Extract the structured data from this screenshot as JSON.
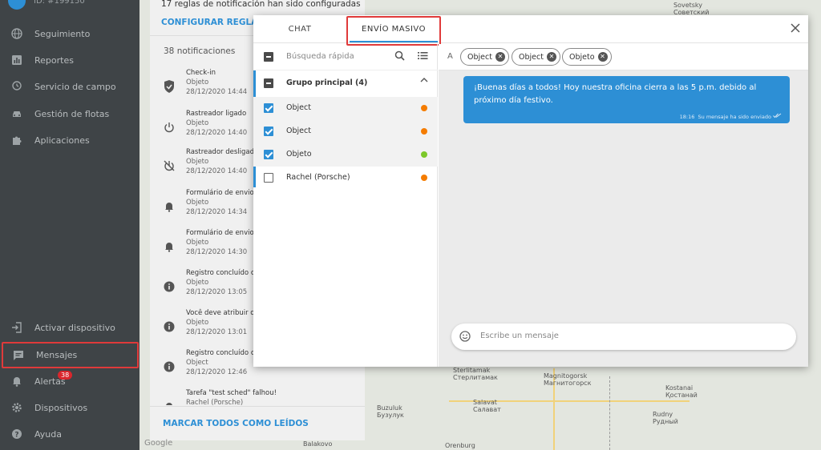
{
  "sidebar": {
    "user_id": "ID: #199150",
    "items": [
      {
        "label": "Seguimiento",
        "icon": "globe-icon"
      },
      {
        "label": "Reportes",
        "icon": "bar-chart-icon"
      },
      {
        "label": "Servicio de campo",
        "icon": "location-pin-icon"
      },
      {
        "label": "Gestión de flotas",
        "icon": "car-icon"
      },
      {
        "label": "Aplicaciones",
        "icon": "puzzle-icon"
      },
      {
        "label": "Activar dispositivo",
        "icon": "login-icon"
      },
      {
        "label": "Mensajes",
        "icon": "chat-icon"
      },
      {
        "label": "Alertas",
        "icon": "bell-icon",
        "badge": "38"
      },
      {
        "label": "Dispositivos",
        "icon": "gear-icon"
      },
      {
        "label": "Ayuda",
        "icon": "help-icon"
      }
    ]
  },
  "notifications": {
    "header": "17 reglas de notificación han sido configuradas",
    "configure": "CONFIGURAR REGLAS",
    "count": "38 notificaciones",
    "items": [
      {
        "title": "Check-in",
        "object": "Objeto",
        "date": "28/12/2020 14:44",
        "icon": "shield-check-icon"
      },
      {
        "title": "Rastreador ligado",
        "object": "Objeto",
        "date": "28/12/2020 14:40",
        "icon": "power-icon"
      },
      {
        "title": "Rastreador desligado",
        "object": "Objeto",
        "date": "28/12/2020 14:40",
        "icon": "power-off-icon"
      },
      {
        "title": "Formulário de envio",
        "object": "Objeto",
        "date": "28/12/2020 14:34",
        "icon": "bell-icon"
      },
      {
        "title": "Formulário de envio",
        "object": "Objeto",
        "date": "28/12/2020 14:30",
        "icon": "bell-icon"
      },
      {
        "title": "Registro concluído co",
        "object": "Objeto",
        "date": "28/12/2020 13:05",
        "icon": "info-icon"
      },
      {
        "title": "Você deve atribuir o",
        "object": "Objeto",
        "date": "28/12/2020 13:01",
        "icon": "info-icon"
      },
      {
        "title": "Registro concluído co",
        "object": "Object",
        "date": "28/12/2020 12:46",
        "icon": "info-icon"
      },
      {
        "title": "Tarefa \"test sched\" falhou!",
        "object": "Rachel (Porsche)",
        "date": "",
        "icon": "bell-icon"
      }
    ],
    "mark_all": "MARCAR TODOS COMO LEÍDOS"
  },
  "dialog": {
    "tabs": [
      {
        "label": "CHAT"
      },
      {
        "label": "ENVÍO MASIVO"
      }
    ],
    "search_placeholder": "Búsqueda rápida",
    "group_label": "Grupo principal (4)",
    "objects": [
      {
        "label": "Object",
        "checked": true,
        "status_color": "#f57c00"
      },
      {
        "label": "Object",
        "checked": true,
        "status_color": "#f57c00"
      },
      {
        "label": "Objeto",
        "checked": true,
        "status_color": "#7cc82a"
      },
      {
        "label": "Rachel (Porsche)",
        "checked": false,
        "status_color": "#f57c00"
      }
    ],
    "to_label": "A",
    "recipients": [
      "Object",
      "Object",
      "Objeto"
    ],
    "message": {
      "text": "¡Buenas días a todos! Hoy nuestra oficina cierra a las 5 p.m. debido al próximo día festivo.",
      "time": "18:16",
      "status": "Su mensaje ha sido enviado"
    },
    "compose_placeholder": "Escribe un mensaje"
  },
  "map": {
    "labels": [
      "Sterlitamak\nСтерлитамак",
      "Magnitogorsk\nМагнитогорск",
      "Kostanai\nҚостанай",
      "Salavat\nСалават",
      "Buzuluk\nБузулук",
      "Orenburg",
      "Balakovo",
      "Rudny\nРудный",
      "Sovetsky\nСоветский"
    ],
    "attribution": "Google"
  },
  "colors": {
    "accent": "#2d8fd5",
    "sidebar_bg": "#3f4447",
    "highlight": "#e03a3a"
  }
}
